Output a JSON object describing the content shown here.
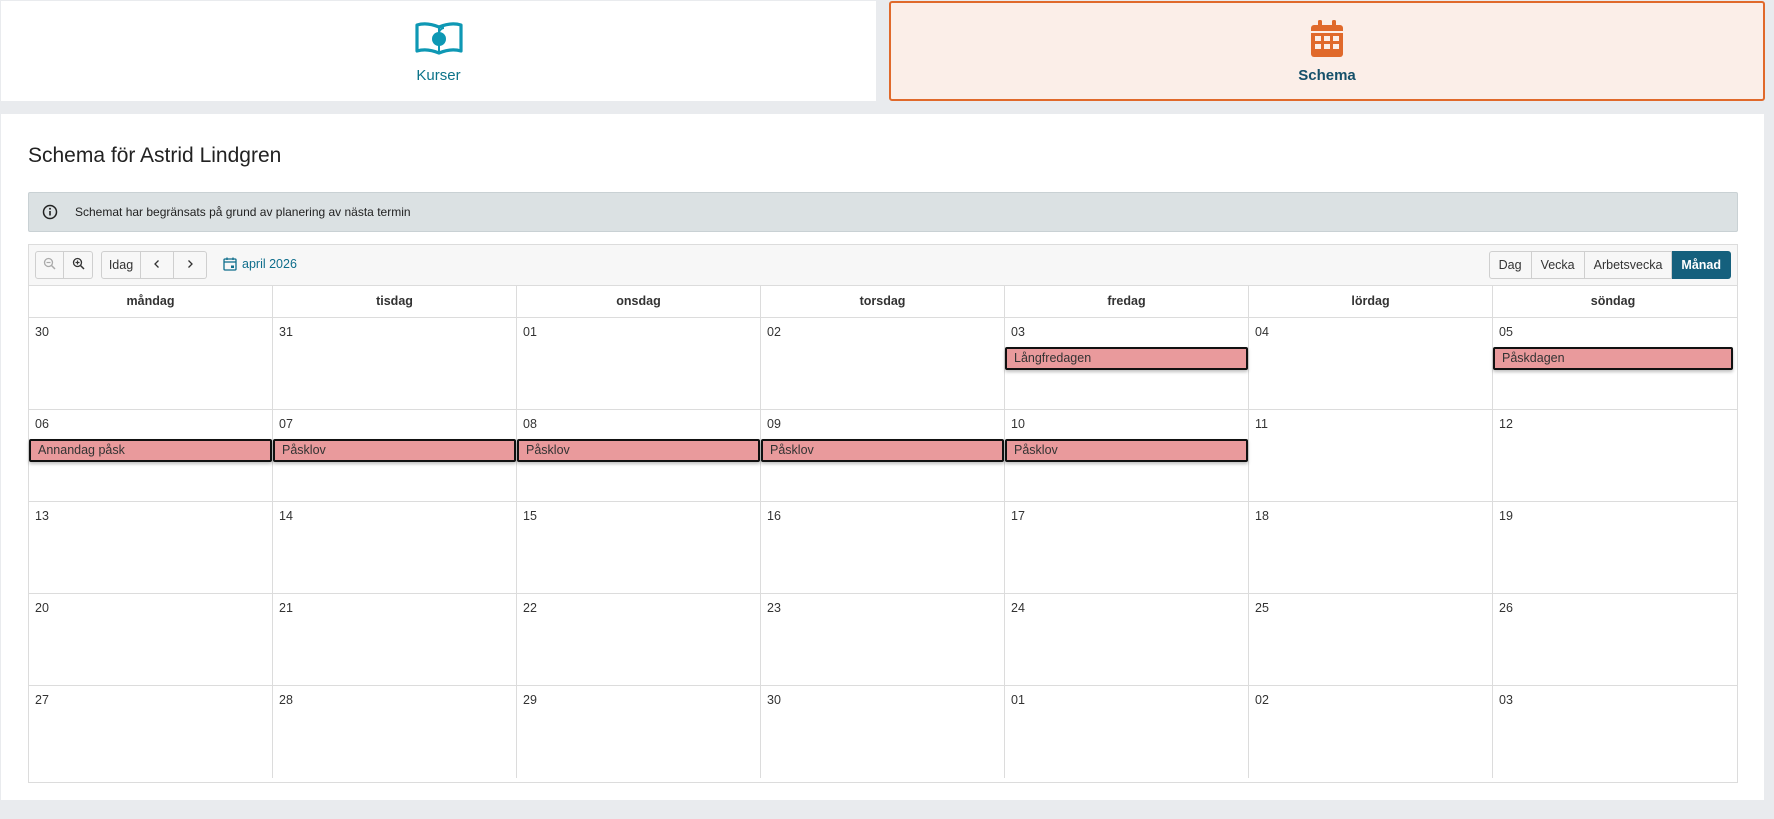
{
  "tabs": {
    "kurser": {
      "label": "Kurser",
      "icon": "book-apple-icon",
      "color": "#0c7389"
    },
    "schema": {
      "label": "Schema",
      "icon": "calendar-icon",
      "color": "#e0692b",
      "active": true
    }
  },
  "page": {
    "title": "Schema för Astrid Lindgren"
  },
  "notice": {
    "icon": "info-icon",
    "text": "Schemat har begränsats på grund av planering av nästa termin"
  },
  "toolbar": {
    "zoom_out_icon": "zoom-out-icon",
    "zoom_in_icon": "zoom-in-icon",
    "today_label": "Idag",
    "prev_icon": "chevron-left-icon",
    "next_icon": "chevron-right-icon",
    "current_period": "april 2026",
    "views": [
      "Dag",
      "Vecka",
      "Arbetsvecka",
      "Månad"
    ],
    "active_view": "Månad"
  },
  "calendar": {
    "weekdays": [
      "måndag",
      "tisdag",
      "onsdag",
      "torsdag",
      "fredag",
      "lördag",
      "söndag"
    ],
    "weeks": [
      {
        "days": [
          {
            "num": "30"
          },
          {
            "num": "31"
          },
          {
            "num": "01"
          },
          {
            "num": "02"
          },
          {
            "num": "03",
            "event": "Långfredagen"
          },
          {
            "num": "04"
          },
          {
            "num": "05",
            "event": "Påskdagen"
          }
        ]
      },
      {
        "days": [
          {
            "num": "06",
            "event": "Annandag påsk"
          },
          {
            "num": "07",
            "event": "Påsklov"
          },
          {
            "num": "08",
            "event": "Påsklov"
          },
          {
            "num": "09",
            "event": "Påsklov"
          },
          {
            "num": "10",
            "event": "Påsklov"
          },
          {
            "num": "11"
          },
          {
            "num": "12"
          }
        ]
      },
      {
        "days": [
          {
            "num": "13"
          },
          {
            "num": "14"
          },
          {
            "num": "15"
          },
          {
            "num": "16"
          },
          {
            "num": "17"
          },
          {
            "num": "18"
          },
          {
            "num": "19"
          }
        ]
      },
      {
        "days": [
          {
            "num": "20"
          },
          {
            "num": "21"
          },
          {
            "num": "22"
          },
          {
            "num": "23"
          },
          {
            "num": "24"
          },
          {
            "num": "25"
          },
          {
            "num": "26"
          }
        ]
      },
      {
        "days": [
          {
            "num": "27"
          },
          {
            "num": "28"
          },
          {
            "num": "29"
          },
          {
            "num": "30"
          },
          {
            "num": "01"
          },
          {
            "num": "02"
          },
          {
            "num": "03"
          }
        ]
      }
    ],
    "event_color": "#e99a9c"
  }
}
